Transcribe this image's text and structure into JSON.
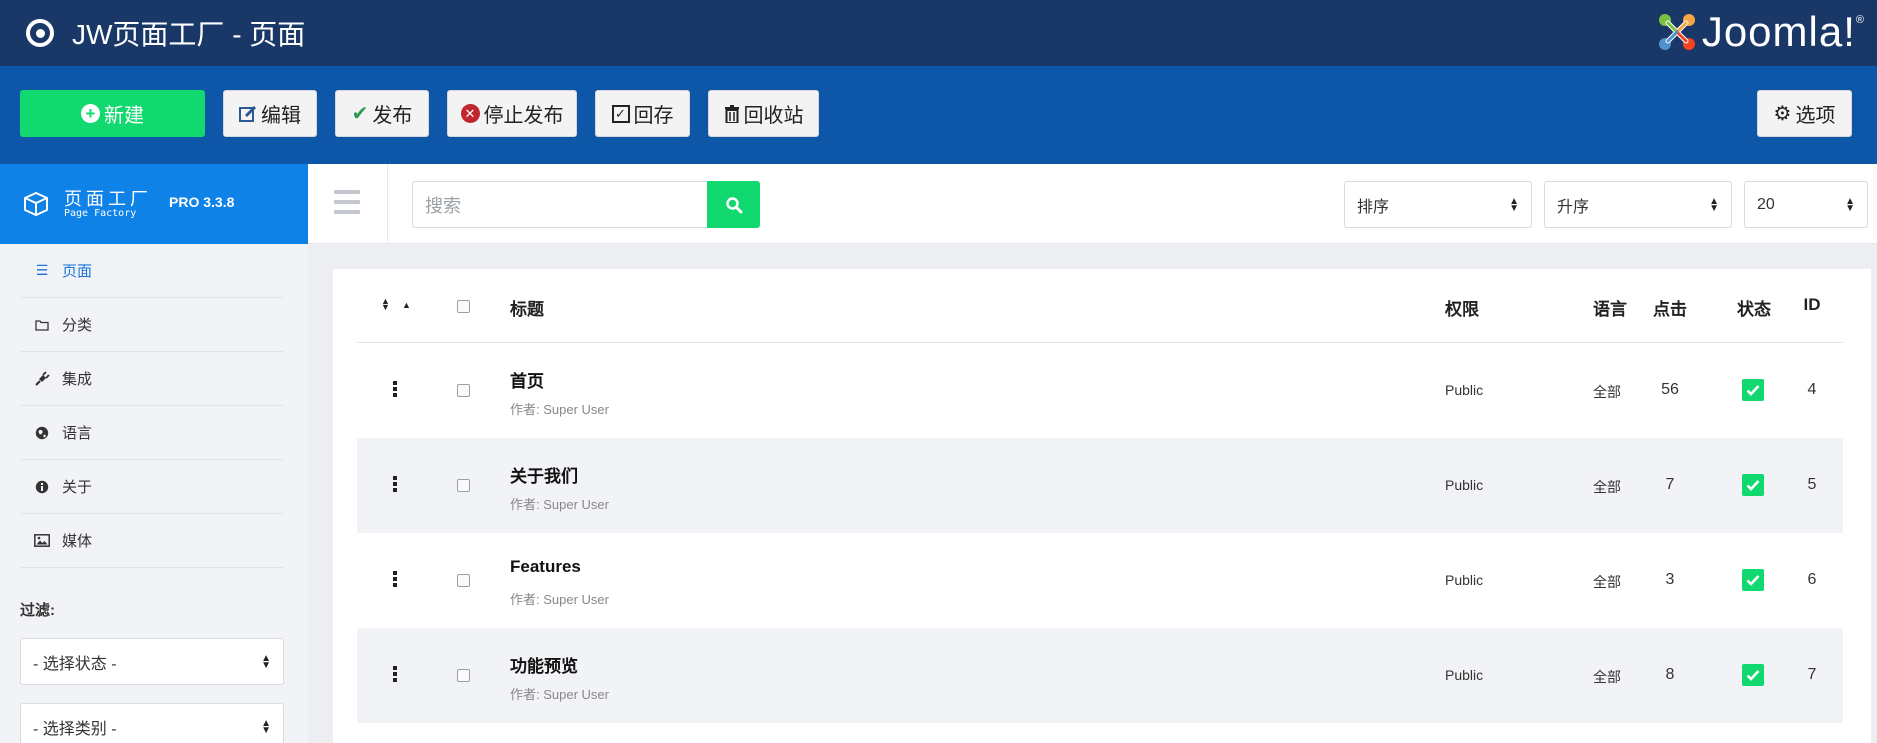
{
  "header": {
    "title": "JW页面工厂 - 页面",
    "brand_logo": "Joomla!"
  },
  "toolbar": {
    "new_label": "新建",
    "edit_label": "编辑",
    "publish_label": "发布",
    "unpublish_label": "停止发布",
    "archive_label": "回存",
    "trash_label": "回收站",
    "options_label": "选项"
  },
  "sidebar": {
    "brand_cn": "页面工厂",
    "brand_en": "Page Factory",
    "version": "PRO 3.3.8",
    "items": [
      {
        "label": "页面",
        "icon": "list-icon",
        "active": true
      },
      {
        "label": "分类",
        "icon": "folder-icon",
        "active": false
      },
      {
        "label": "集成",
        "icon": "plug-icon",
        "active": false
      },
      {
        "label": "语言",
        "icon": "globe-icon",
        "active": false
      },
      {
        "label": "关于",
        "icon": "info-icon",
        "active": false
      },
      {
        "label": "媒体",
        "icon": "image-icon",
        "active": false
      }
    ],
    "filter_label": "过滤:",
    "status_select": "- 选择状态 -",
    "category_select": "- 选择类别 -"
  },
  "search": {
    "placeholder": "搜索",
    "order_by": "排序",
    "direction": "升序",
    "limit": "20"
  },
  "table": {
    "headers": {
      "title": "标题",
      "access": "权限",
      "language": "语言",
      "hits": "点击",
      "status": "状态",
      "id": "ID"
    },
    "rows": [
      {
        "title": "首页",
        "author": "作者: Super User",
        "access": "Public",
        "language": "全部",
        "hits": "56",
        "id": "4",
        "published": true
      },
      {
        "title": "关于我们",
        "author": "作者: Super User",
        "access": "Public",
        "language": "全部",
        "hits": "7",
        "id": "5",
        "published": true
      },
      {
        "title": "Features",
        "author": "作者: Super User",
        "access": "Public",
        "language": "全部",
        "hits": "3",
        "id": "6",
        "published": true
      },
      {
        "title": "功能预览",
        "author": "作者: Super User",
        "access": "Public",
        "language": "全部",
        "hits": "8",
        "id": "7",
        "published": true
      }
    ]
  },
  "colors": {
    "header_bg": "#1a3867",
    "toolbar_bg": "#0e56a8",
    "brand_bg": "#0f82e8",
    "accent_green": "#12d870",
    "active_link": "#1a73d8"
  }
}
